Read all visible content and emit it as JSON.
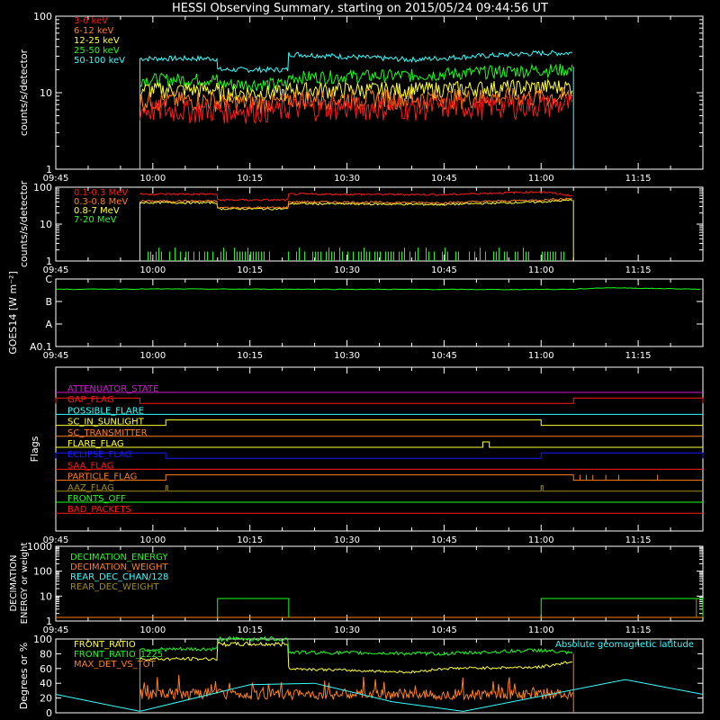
{
  "title": "HESSI Observing Summary, starting on 2015/05/24 09:44:56 UT",
  "colors": {
    "background": "#000000",
    "axis": "#ffffff",
    "red": "#ff1a1a",
    "orange": "#ff7f1a",
    "yellow": "#ffff33",
    "green": "#1aff1a",
    "cyan": "#33ffff",
    "magenta": "#d01ad0",
    "blue": "#1a1aff",
    "olive": "#a08c1a"
  },
  "x_tick_labels": [
    "09:45",
    "10:00",
    "10:15",
    "10:30",
    "10:45",
    "11:00",
    "11:15"
  ],
  "chart_data": [
    {
      "type": "line",
      "title": "HESSI Observing Summary, starting on 2015/05/24 09:44:56 UT",
      "ylabel": "counts/s/detector",
      "y_scale": "log",
      "ylim": [
        1,
        100
      ],
      "y_tick_labels": [
        "1",
        "10",
        "100"
      ],
      "xlim": [
        "09:45",
        "11:25"
      ],
      "series": [
        {
          "name": "3-6 keV",
          "color": "red",
          "x": [
            "09:58",
            "10:10",
            "10:10",
            "10:21",
            "10:21",
            "10:40",
            "11:00",
            "11:05",
            "11:05"
          ],
          "values": [
            6,
            6,
            6,
            6,
            6.5,
            6.5,
            7,
            7,
            8
          ]
        },
        {
          "name": "6-12 keV",
          "color": "orange",
          "x": [
            "09:58",
            "10:10",
            "10:10",
            "10:21",
            "10:21",
            "10:40",
            "11:00",
            "11:05",
            "11:05"
          ],
          "values": [
            8,
            8,
            7.5,
            7.5,
            8.5,
            8.5,
            9,
            9,
            10
          ]
        },
        {
          "name": "12-25 keV",
          "color": "yellow",
          "x": [
            "09:58",
            "10:10",
            "10:10",
            "10:21",
            "10:21",
            "10:40",
            "11:00",
            "11:05",
            "11:05"
          ],
          "values": [
            11,
            11,
            10,
            10,
            11,
            11,
            12,
            12,
            13
          ]
        },
        {
          "name": "25-50 keV",
          "color": "green",
          "x": [
            "09:58",
            "10:10",
            "10:10",
            "10:21",
            "10:21",
            "10:40",
            "11:00",
            "11:05",
            "11:05"
          ],
          "values": [
            15,
            15,
            13,
            13,
            16,
            17,
            20,
            20,
            17
          ]
        },
        {
          "name": "50-100 keV",
          "color": "cyan",
          "x": [
            "09:58",
            "10:10",
            "10:10",
            "10:21",
            "10:21",
            "10:40",
            "11:00",
            "11:05",
            "11:05"
          ],
          "values": [
            28,
            28,
            20,
            20,
            32,
            27,
            33,
            33,
            22
          ]
        }
      ]
    },
    {
      "type": "line",
      "ylabel": "counts/s/detector",
      "y_scale": "log",
      "ylim": [
        1,
        100
      ],
      "y_tick_labels": [
        "1",
        "10",
        "100"
      ],
      "series": [
        {
          "name": "0.1-0.3 MeV",
          "color": "red",
          "x": [
            "09:58",
            "10:10",
            "10:10",
            "10:21",
            "10:21",
            "10:45",
            "11:00",
            "11:05"
          ],
          "values": [
            65,
            65,
            45,
            45,
            65,
            63,
            75,
            58
          ]
        },
        {
          "name": "0.3-0.8 MeV",
          "color": "orange",
          "x": [
            "09:58",
            "10:10",
            "10:10",
            "10:21",
            "10:21",
            "10:45",
            "11:00",
            "11:05"
          ],
          "values": [
            42,
            42,
            28,
            28,
            40,
            38,
            45,
            50
          ]
        },
        {
          "name": "0.8-7 MeV",
          "color": "yellow",
          "x": [
            "09:58",
            "10:10",
            "10:10",
            "10:21",
            "10:21",
            "10:45",
            "11:00",
            "11:05"
          ],
          "values": [
            38,
            38,
            26,
            26,
            36,
            34,
            40,
            45
          ]
        },
        {
          "name": "7-20 MeV",
          "color": "green",
          "x": [
            "09:58",
            "10:45",
            "11:00",
            "11:05"
          ],
          "values": [
            1.4,
            1.4,
            2,
            4
          ]
        }
      ]
    },
    {
      "type": "line",
      "ylabel": "GOES14 [W m⁻²]",
      "y_tick_labels": [
        "A0.1",
        "A",
        "B",
        "C"
      ],
      "series": [
        {
          "name": "GOES14",
          "color": "green",
          "x": [
            "09:45",
            "10:00",
            "10:30",
            "10:55",
            "11:05",
            "11:10",
            "11:25"
          ],
          "values": [
            3.5e-07,
            3.6e-07,
            3.5e-07,
            3.4e-07,
            3.5e-07,
            4.1e-07,
            3.5e-07
          ]
        }
      ]
    },
    {
      "type": "line",
      "ylabel": "Flags",
      "flags": [
        {
          "name": "ATTENUATOR_STATE",
          "color": "magenta",
          "segments": []
        },
        {
          "name": "GAP_FLAG",
          "color": "red",
          "segments": [
            [
              "09:45",
              "09:58"
            ],
            [
              "11:05",
              "11:25"
            ]
          ]
        },
        {
          "name": "POSSIBLE_FLARE",
          "color": "cyan",
          "segments": []
        },
        {
          "name": "SC_IN_SUNLIGHT",
          "color": "yellow",
          "segments": [
            [
              "10:02",
              "11:00"
            ]
          ]
        },
        {
          "name": "SC_TRANSMITTER",
          "color": "orange",
          "segments": []
        },
        {
          "name": "FLARE_FLAG",
          "color": "yellow",
          "segments": [
            [
              "10:51",
              "10:52"
            ]
          ]
        },
        {
          "name": "ECLIPSE_FLAG",
          "color": "blue",
          "segments": [
            [
              "09:45",
              "10:02"
            ],
            [
              "11:00",
              "11:25"
            ]
          ]
        },
        {
          "name": "SAA_FLAG",
          "color": "red",
          "segments": []
        },
        {
          "name": "PARTICLE_FLAG",
          "color": "orange",
          "segments": [
            [
              "10:02",
              "11:05"
            ]
          ]
        },
        {
          "name": "AAZ_FLAG",
          "color": "olive",
          "segments": [
            [
              "10:02",
              "10:02"
            ],
            [
              "11:00",
              "11:00"
            ]
          ]
        },
        {
          "name": "FRONTS_OFF",
          "color": "green",
          "segments": []
        },
        {
          "name": "BAD_PACKETS",
          "color": "red",
          "segments": []
        }
      ]
    },
    {
      "type": "line",
      "ylabel": "DECIMATION ENERGY or weight",
      "y_scale": "log",
      "ylim": [
        1,
        1000
      ],
      "y_tick_labels": [
        "1",
        "10",
        "100",
        "1000"
      ],
      "series": [
        {
          "name": "DECIMATION_ENERGY",
          "color": "green",
          "x": [
            "10:10",
            "10:21",
            "11:00",
            "11:25"
          ],
          "values": [
            8,
            8,
            8,
            8
          ]
        },
        {
          "name": "DECIMATION_WEIGHT",
          "color": "orange",
          "x": [
            "09:45",
            "11:25"
          ],
          "values": [
            1.4,
            1.4
          ]
        },
        {
          "name": "REAR_DEC_CHAN/128",
          "color": "cyan",
          "x": [],
          "values": []
        },
        {
          "name": "REAR_DEC_WEIGHT",
          "color": "olive",
          "x": [],
          "values": []
        }
      ]
    },
    {
      "type": "line",
      "ylabel": "Degrees or %",
      "ylim": [
        0,
        100
      ],
      "y_tick_labels": [
        "0",
        "20",
        "40",
        "60",
        "80",
        "100"
      ],
      "series": [
        {
          "name": "FRONT_RATIO",
          "color": "yellow",
          "x": [
            "09:58",
            "10:10",
            "10:10",
            "10:21",
            "10:21",
            "10:40",
            "10:45",
            "11:00",
            "11:05"
          ],
          "values": [
            73,
            73,
            93,
            93,
            60,
            55,
            60,
            62,
            70
          ]
        },
        {
          "name": "FRONT_RATIO_1225",
          "color": "green",
          "x": [
            "09:58",
            "10:10",
            "10:10",
            "10:21",
            "10:21",
            "10:45",
            "11:00",
            "11:05"
          ],
          "values": [
            86,
            86,
            100,
            100,
            82,
            80,
            85,
            80
          ]
        },
        {
          "name": "MAX_DET_VS_TOT",
          "color": "orange",
          "x": [
            "09:58",
            "10:30",
            "11:05"
          ],
          "values": [
            25,
            25,
            27
          ]
        },
        {
          "name": "Absolute geomagnetic latitude",
          "color": "cyan",
          "x": [
            "09:45",
            "09:58",
            "10:15",
            "10:25",
            "10:37",
            "10:48",
            "11:13",
            "11:25"
          ],
          "values": [
            25,
            2,
            38,
            40,
            15,
            2,
            45,
            25
          ]
        }
      ]
    }
  ]
}
